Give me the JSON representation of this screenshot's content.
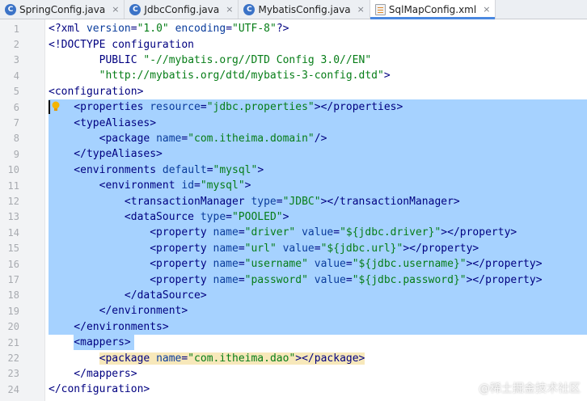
{
  "tabs": [
    {
      "label": "SpringConfig.java",
      "icon": "java-class-icon",
      "active": false
    },
    {
      "label": "JdbcConfig.java",
      "icon": "java-class-icon",
      "active": false
    },
    {
      "label": "MybatisConfig.java",
      "icon": "java-class-icon",
      "active": false
    },
    {
      "label": "SqlMapConfig.xml",
      "icon": "xml-file-icon",
      "active": true
    }
  ],
  "tab_close_glyph": "×",
  "colors": {
    "selection": "#a6d2ff",
    "tag": "#000080",
    "attribute": "#0a3c9c",
    "string": "#067d17",
    "active_tab_underline": "#4a88e0"
  },
  "editor": {
    "lines": [
      {
        "num": "1",
        "tokens": [
          [
            "pi",
            "<?xml "
          ],
          [
            "attr",
            "version"
          ],
          [
            "tag",
            "="
          ],
          [
            "val",
            "\"1.0\""
          ],
          [
            "tag",
            " "
          ],
          [
            "attr",
            "encoding"
          ],
          [
            "tag",
            "="
          ],
          [
            "val",
            "\"UTF-8\""
          ],
          [
            "pi",
            "?>"
          ]
        ]
      },
      {
        "num": "2",
        "tokens": [
          [
            "tag",
            "<!DOCTYPE configuration"
          ]
        ]
      },
      {
        "num": "3",
        "tokens": [
          [
            "tag",
            "        PUBLIC "
          ],
          [
            "val",
            "\"-//mybatis.org//DTD Config 3.0//EN\""
          ]
        ]
      },
      {
        "num": "4",
        "tokens": [
          [
            "val",
            "        \"http://mybatis.org/dtd/mybatis-3-config.dtd\""
          ],
          [
            "tag",
            ">"
          ]
        ]
      },
      {
        "num": "5",
        "tokens": [
          [
            "tag",
            "<configuration>"
          ]
        ]
      },
      {
        "num": "6",
        "tokens": [
          [
            "tag",
            "    <properties "
          ],
          [
            "attr",
            "resource"
          ],
          [
            "tag",
            "="
          ],
          [
            "val",
            "\"jdbc.properties\""
          ],
          [
            "tag",
            "></properties>"
          ]
        ]
      },
      {
        "num": "7",
        "tokens": [
          [
            "tag",
            "    <typeAliases>"
          ]
        ]
      },
      {
        "num": "8",
        "tokens": [
          [
            "tag",
            "        <package "
          ],
          [
            "attr",
            "name"
          ],
          [
            "tag",
            "="
          ],
          [
            "val",
            "\"com.itheima.domain\""
          ],
          [
            "tag",
            "/>"
          ]
        ]
      },
      {
        "num": "9",
        "tokens": [
          [
            "tag",
            "    </typeAliases>"
          ]
        ]
      },
      {
        "num": "10",
        "tokens": [
          [
            "tag",
            "    <environments "
          ],
          [
            "attr",
            "default"
          ],
          [
            "tag",
            "="
          ],
          [
            "val",
            "\"mysql\""
          ],
          [
            "tag",
            ">"
          ]
        ]
      },
      {
        "num": "11",
        "tokens": [
          [
            "tag",
            "        <environment "
          ],
          [
            "attr",
            "id"
          ],
          [
            "tag",
            "="
          ],
          [
            "val",
            "\"mysql\""
          ],
          [
            "tag",
            ">"
          ]
        ]
      },
      {
        "num": "12",
        "tokens": [
          [
            "tag",
            "            <transactionManager "
          ],
          [
            "attr",
            "type"
          ],
          [
            "tag",
            "="
          ],
          [
            "val",
            "\"JDBC\""
          ],
          [
            "tag",
            "></transactionManager>"
          ]
        ]
      },
      {
        "num": "13",
        "tokens": [
          [
            "tag",
            "            <dataSource "
          ],
          [
            "attr",
            "type"
          ],
          [
            "tag",
            "="
          ],
          [
            "val",
            "\"POOLED\""
          ],
          [
            "tag",
            ">"
          ]
        ]
      },
      {
        "num": "14",
        "tokens": [
          [
            "tag",
            "                <property "
          ],
          [
            "attr",
            "name"
          ],
          [
            "tag",
            "="
          ],
          [
            "val",
            "\"driver\""
          ],
          [
            "tag",
            " "
          ],
          [
            "attr",
            "value"
          ],
          [
            "tag",
            "="
          ],
          [
            "val",
            "\"${jdbc.driver}\""
          ],
          [
            "tag",
            "></property>"
          ]
        ]
      },
      {
        "num": "15",
        "tokens": [
          [
            "tag",
            "                <property "
          ],
          [
            "attr",
            "name"
          ],
          [
            "tag",
            "="
          ],
          [
            "val",
            "\"url\""
          ],
          [
            "tag",
            " "
          ],
          [
            "attr",
            "value"
          ],
          [
            "tag",
            "="
          ],
          [
            "val",
            "\"${jdbc.url}\""
          ],
          [
            "tag",
            "></property>"
          ]
        ]
      },
      {
        "num": "16",
        "tokens": [
          [
            "tag",
            "                <property "
          ],
          [
            "attr",
            "name"
          ],
          [
            "tag",
            "="
          ],
          [
            "val",
            "\"username\""
          ],
          [
            "tag",
            " "
          ],
          [
            "attr",
            "value"
          ],
          [
            "tag",
            "="
          ],
          [
            "val",
            "\"${jdbc.username}\""
          ],
          [
            "tag",
            "></property>"
          ]
        ]
      },
      {
        "num": "17",
        "tokens": [
          [
            "tag",
            "                <property "
          ],
          [
            "attr",
            "name"
          ],
          [
            "tag",
            "="
          ],
          [
            "val",
            "\"password\""
          ],
          [
            "tag",
            " "
          ],
          [
            "attr",
            "value"
          ],
          [
            "tag",
            "="
          ],
          [
            "val",
            "\"${jdbc.password}\""
          ],
          [
            "tag",
            "></property>"
          ]
        ]
      },
      {
        "num": "18",
        "tokens": [
          [
            "tag",
            "            </dataSource>"
          ]
        ]
      },
      {
        "num": "19",
        "tokens": [
          [
            "tag",
            "        </environment>"
          ]
        ]
      },
      {
        "num": "20",
        "tokens": [
          [
            "tag",
            "    </environments>"
          ]
        ]
      },
      {
        "num": "21",
        "tokens": [
          [
            "tag",
            "    <mappers>"
          ]
        ]
      },
      {
        "num": "22",
        "tokens": [
          [
            "tag",
            "        "
          ],
          [
            "hltag",
            "<package "
          ],
          [
            "hlattr",
            "name"
          ],
          [
            "hltag",
            "="
          ],
          [
            "hlval",
            "\"com.itheima.dao\""
          ],
          [
            "hltag",
            "></package>"
          ]
        ]
      },
      {
        "num": "23",
        "tokens": [
          [
            "tag",
            "    </mappers>"
          ]
        ]
      },
      {
        "num": "24",
        "tokens": [
          [
            "tag",
            "</configuration>"
          ]
        ]
      }
    ],
    "selected_lines": [
      "6",
      "7",
      "8",
      "9",
      "10",
      "11",
      "12",
      "13",
      "14",
      "15",
      "16",
      "17",
      "18",
      "19",
      "20",
      "21"
    ],
    "bulb_line": "6"
  },
  "watermark": "@稀土掘金技术社区"
}
